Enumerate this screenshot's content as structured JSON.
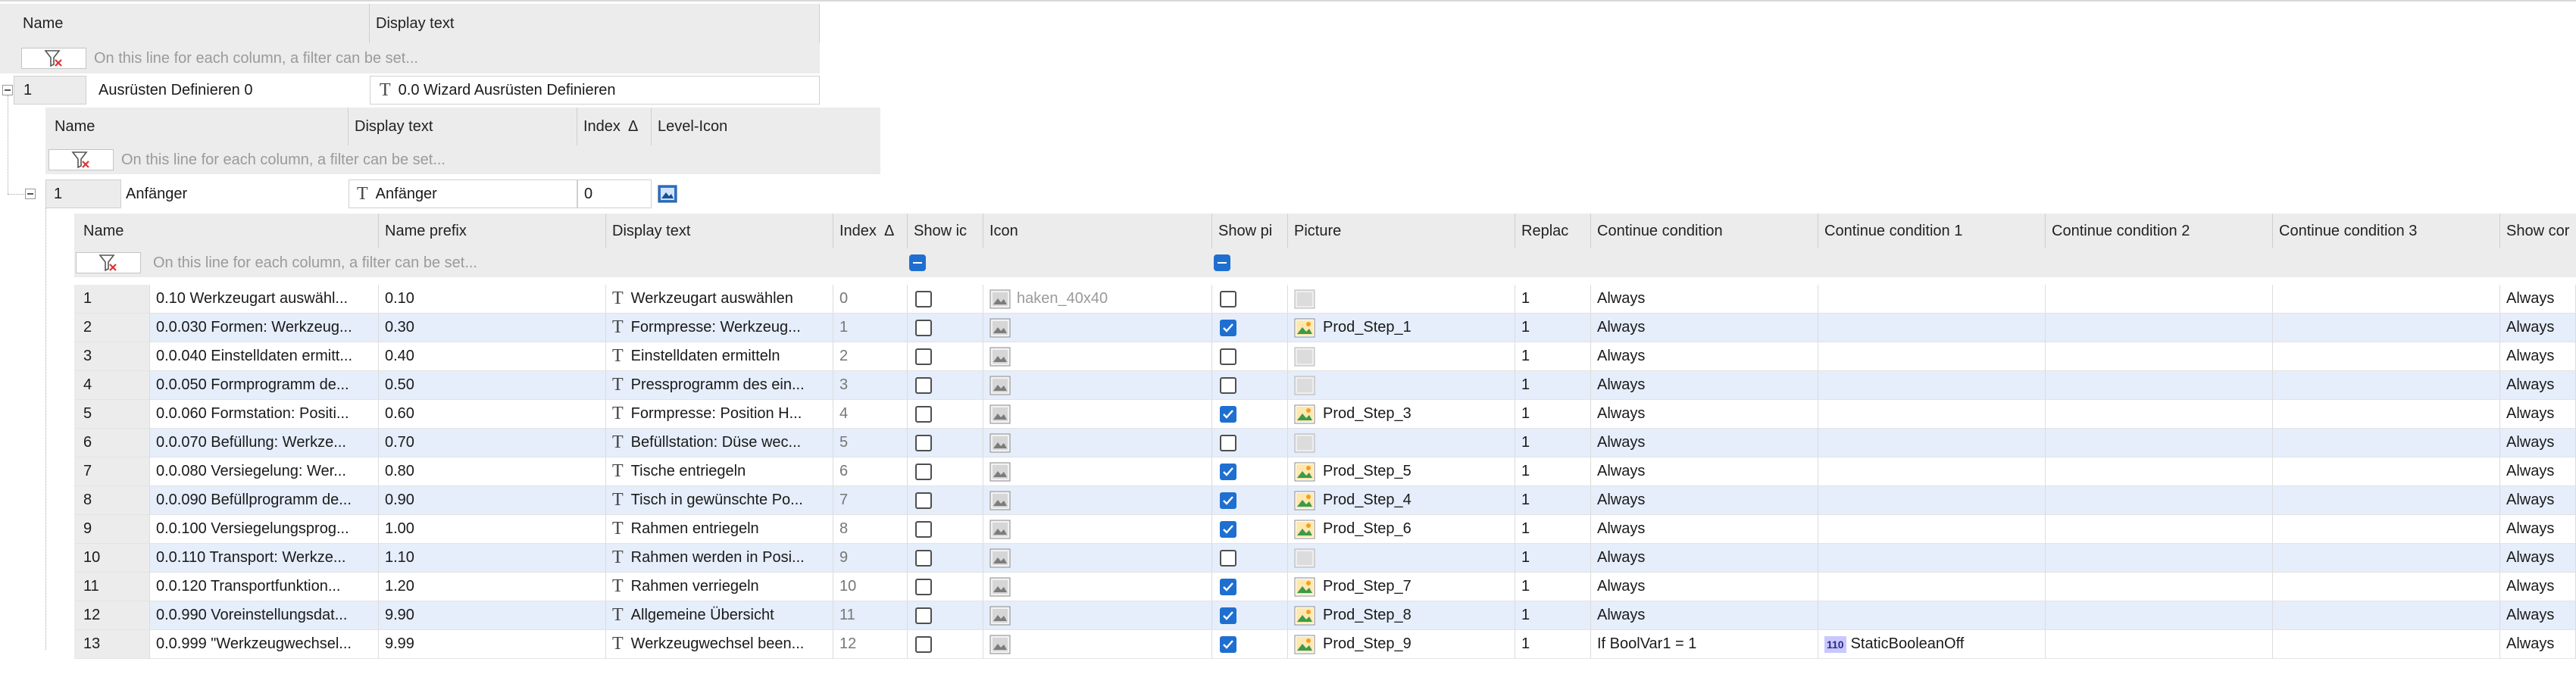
{
  "filter_placeholder": "On this line for each column, a filter can be set...",
  "level0": {
    "headers": {
      "name": "Name",
      "display_text": "Display text"
    },
    "row": {
      "num": "1",
      "name": "Ausrüsten Definieren 0",
      "display_text": "0.0 Wizard Ausrüsten Definieren"
    }
  },
  "level1": {
    "headers": {
      "name": "Name",
      "display_text": "Display text",
      "index": "Index",
      "level_icon": "Level-Icon",
      "sort_glyph": "Δ"
    },
    "row": {
      "num": "1",
      "name": "Anfänger",
      "display_text": "Anfänger",
      "index": "0"
    }
  },
  "grid": {
    "headers": {
      "name": "Name",
      "name_prefix": "Name prefix",
      "display_text": "Display text",
      "index": "Index",
      "sort_glyph": "Δ",
      "show_icon": "Show ic",
      "icon": "Icon",
      "show_picture": "Show pi",
      "picture": "Picture",
      "replace": "Replac",
      "cont": "Continue condition",
      "cont1": "Continue condition 1",
      "cont2": "Continue condition 2",
      "cont3": "Continue condition 3",
      "show_cont": "Show cor"
    },
    "rows": [
      {
        "num": "1",
        "name": "0.10 Werkzeugart auswähl...",
        "prefix": "0.10",
        "text": "Werkzeugart auswählen",
        "index": "0",
        "show_icon": false,
        "icon": "haken_40x40",
        "show_pic": false,
        "picture": "",
        "has_pic": false,
        "replace": "1",
        "cont": "Always",
        "cont1": "",
        "cont1_badge": false,
        "show_cont": "Always"
      },
      {
        "num": "2",
        "name": "0.0.030 Formen: Werkzeug...",
        "prefix": "0.30",
        "text": "Formpresse: Werkzeug...",
        "index": "1",
        "show_icon": false,
        "icon": "",
        "show_pic": true,
        "picture": "Prod_Step_1",
        "has_pic": true,
        "replace": "1",
        "cont": "Always",
        "cont1": "",
        "cont1_badge": false,
        "show_cont": "Always"
      },
      {
        "num": "3",
        "name": "0.0.040 Einstelldaten ermitt...",
        "prefix": "0.40",
        "text": "Einstelldaten ermitteln",
        "index": "2",
        "show_icon": false,
        "icon": "",
        "show_pic": false,
        "picture": "",
        "has_pic": false,
        "replace": "1",
        "cont": "Always",
        "cont1": "",
        "cont1_badge": false,
        "show_cont": "Always"
      },
      {
        "num": "4",
        "name": "0.0.050 Formprogramm de...",
        "prefix": "0.50",
        "text": "Pressprogramm des ein...",
        "index": "3",
        "show_icon": false,
        "icon": "",
        "show_pic": false,
        "picture": "",
        "has_pic": false,
        "replace": "1",
        "cont": "Always",
        "cont1": "",
        "cont1_badge": false,
        "show_cont": "Always"
      },
      {
        "num": "5",
        "name": "0.0.060 Formstation: Positi...",
        "prefix": "0.60",
        "text": "Formpresse: Position H...",
        "index": "4",
        "show_icon": false,
        "icon": "",
        "show_pic": true,
        "picture": "Prod_Step_3",
        "has_pic": true,
        "replace": "1",
        "cont": "Always",
        "cont1": "",
        "cont1_badge": false,
        "show_cont": "Always"
      },
      {
        "num": "6",
        "name": "0.0.070 Befüllung: Werkze...",
        "prefix": "0.70",
        "text": "Befüllstation: Düse wec...",
        "index": "5",
        "show_icon": false,
        "icon": "",
        "show_pic": false,
        "picture": "",
        "has_pic": false,
        "replace": "1",
        "cont": "Always",
        "cont1": "",
        "cont1_badge": false,
        "show_cont": "Always"
      },
      {
        "num": "7",
        "name": "0.0.080 Versiegelung: Wer...",
        "prefix": "0.80",
        "text": "Tische entriegeln",
        "index": "6",
        "show_icon": false,
        "icon": "",
        "show_pic": true,
        "picture": "Prod_Step_5",
        "has_pic": true,
        "replace": "1",
        "cont": "Always",
        "cont1": "",
        "cont1_badge": false,
        "show_cont": "Always"
      },
      {
        "num": "8",
        "name": "0.0.090 Befüllprogramm de...",
        "prefix": "0.90",
        "text": "Tisch in gewünschte Po...",
        "index": "7",
        "show_icon": false,
        "icon": "",
        "show_pic": true,
        "picture": "Prod_Step_4",
        "has_pic": true,
        "replace": "1",
        "cont": "Always",
        "cont1": "",
        "cont1_badge": false,
        "show_cont": "Always"
      },
      {
        "num": "9",
        "name": "0.0.100 Versiegelungsprog...",
        "prefix": "1.00",
        "text": "Rahmen entriegeln",
        "index": "8",
        "show_icon": false,
        "icon": "",
        "show_pic": true,
        "picture": "Prod_Step_6",
        "has_pic": true,
        "replace": "1",
        "cont": "Always",
        "cont1": "",
        "cont1_badge": false,
        "show_cont": "Always"
      },
      {
        "num": "10",
        "name": "0.0.110 Transport: Werkze...",
        "prefix": "1.10",
        "text": "Rahmen werden in Posi...",
        "index": "9",
        "show_icon": false,
        "icon": "",
        "show_pic": false,
        "picture": "",
        "has_pic": false,
        "replace": "1",
        "cont": "Always",
        "cont1": "",
        "cont1_badge": false,
        "show_cont": "Always"
      },
      {
        "num": "11",
        "name": "0.0.120 Transportfunktion...",
        "prefix": "1.20",
        "text": "Rahmen verriegeln",
        "index": "10",
        "show_icon": false,
        "icon": "",
        "show_pic": true,
        "picture": "Prod_Step_7",
        "has_pic": true,
        "replace": "1",
        "cont": "Always",
        "cont1": "",
        "cont1_badge": false,
        "show_cont": "Always"
      },
      {
        "num": "12",
        "name": "0.0.990 Voreinstellungsdat...",
        "prefix": "9.90",
        "text": "Allgemeine Übersicht",
        "index": "11",
        "show_icon": false,
        "icon": "",
        "show_pic": true,
        "picture": "Prod_Step_8",
        "has_pic": true,
        "replace": "1",
        "cont": "Always",
        "cont1": "",
        "cont1_badge": false,
        "show_cont": "Always"
      },
      {
        "num": "13",
        "name": "0.0.999 \"Werkzeugwechsel...",
        "prefix": "9.99",
        "text": "Werkzeugwechsel been...",
        "index": "12",
        "show_icon": false,
        "icon": "",
        "show_pic": true,
        "picture": "Prod_Step_9",
        "has_pic": true,
        "replace": "1",
        "cont": "If BoolVar1 = 1",
        "cont1": "StaticBooleanOff",
        "cont1_badge": true,
        "cont1_badge_text": "110",
        "show_cont": "Always"
      }
    ]
  },
  "icons": {
    "filter": "filter-clear-icon",
    "text_type": "text-type-icon",
    "image": "image-icon",
    "picture": "picture-icon",
    "boolean": "boolean-variable-icon",
    "level": "level-image-icon"
  },
  "colors": {
    "checked": "#1e6fd0",
    "alt_row": "#e5eefa",
    "header": "#ececec"
  }
}
